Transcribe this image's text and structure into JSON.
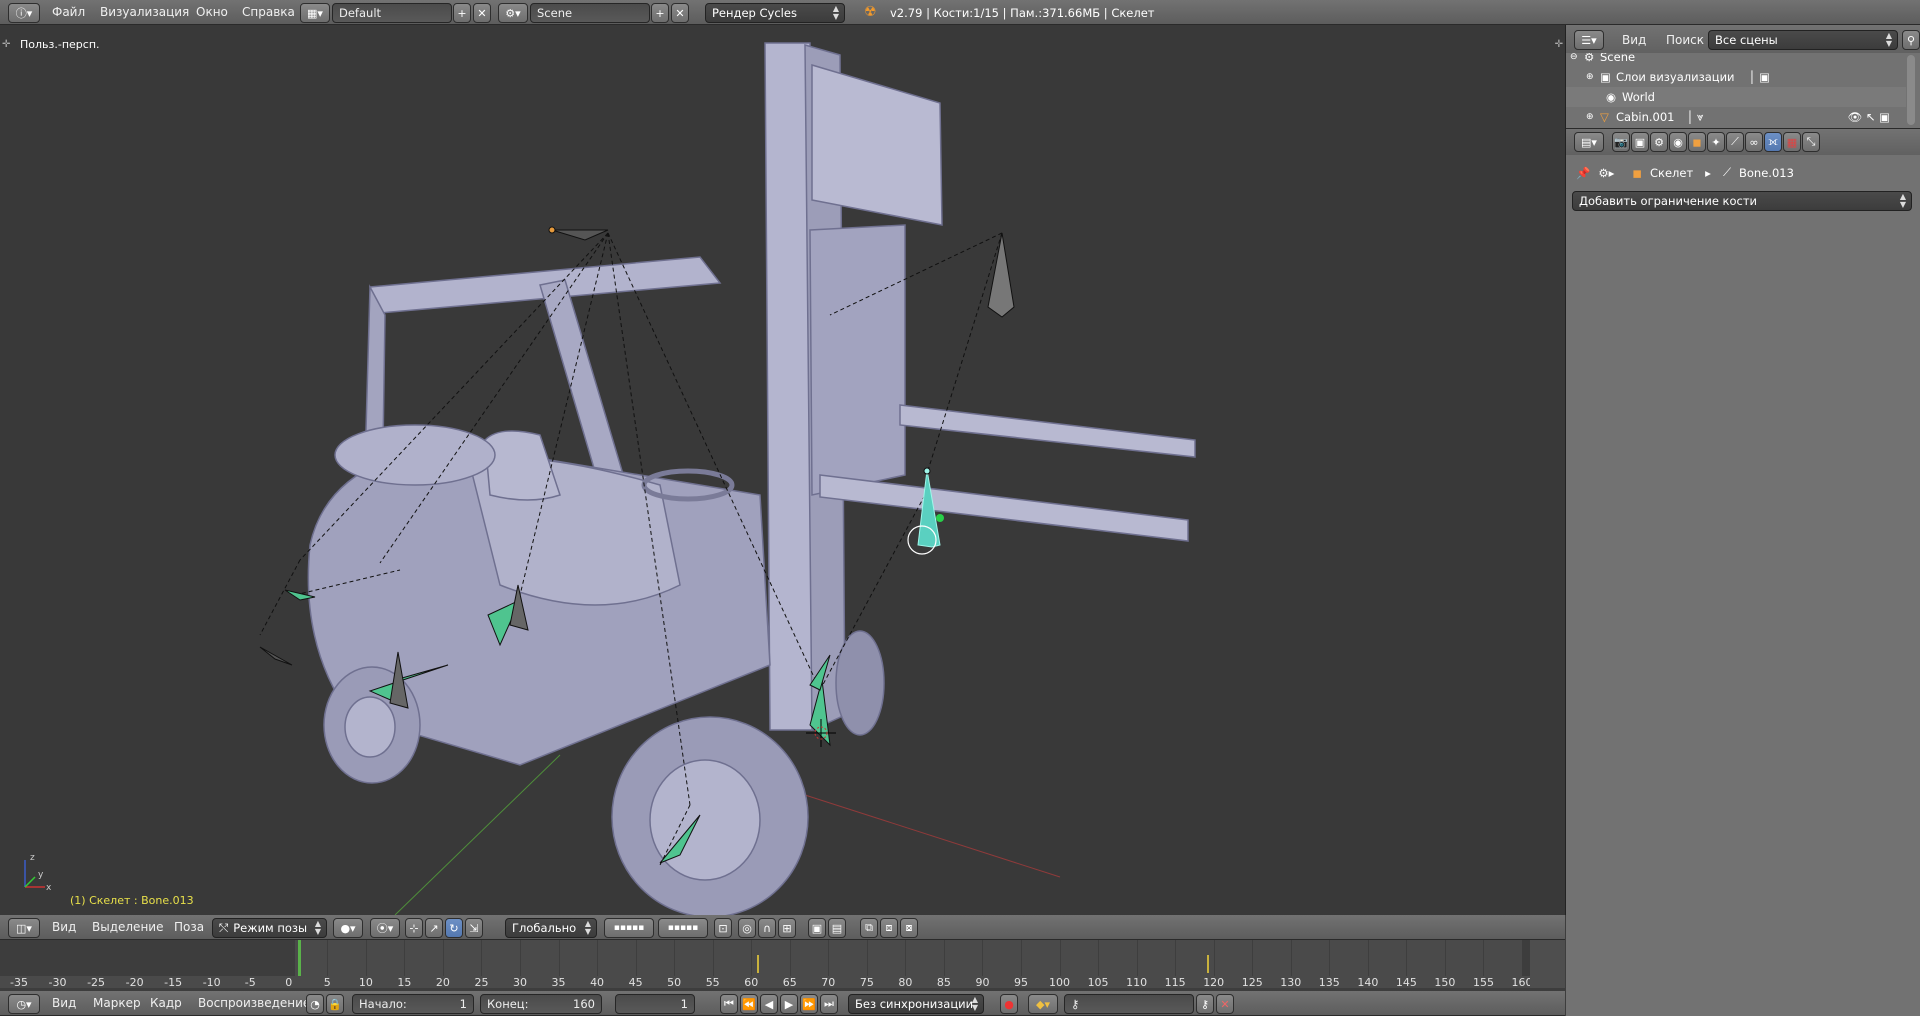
{
  "info_bar": {
    "menus": [
      "Файл",
      "Визуализация",
      "Окно",
      "Справка"
    ],
    "screen_layout": "Default",
    "scene": "Scene",
    "render_engine": "Рендер Cycles",
    "status": "v2.79 | Кости:1/15  | Пам.:371.66МБ | Скелет"
  },
  "viewport": {
    "view_label": "Польз.-персп.",
    "selection_label": "(1) Скелет : Bone.013",
    "axis_labels": {
      "x": "x",
      "y": "y",
      "z": "z"
    }
  },
  "view3d_header": {
    "menus": [
      "Вид",
      "Выделение",
      "Поза"
    ],
    "mode": "Режим позы",
    "orientation": "Глобально"
  },
  "outliner": {
    "header_menus": [
      "Вид",
      "Поиск"
    ],
    "filter": "Все сцены",
    "rows": [
      {
        "label": "Scene"
      },
      {
        "label": "Слои визуализации"
      },
      {
        "label": "World"
      },
      {
        "label": "Cabin.001"
      }
    ]
  },
  "properties": {
    "breadcrumb": [
      "Скелет",
      "Bone.013"
    ],
    "add_constraint": "Добавить ограничение кости"
  },
  "timeline": {
    "ticks": [
      "-35",
      "-30",
      "-25",
      "-20",
      "-15",
      "-10",
      "-5",
      "0",
      "5",
      "10",
      "15",
      "20",
      "25",
      "30",
      "35",
      "40",
      "45",
      "50",
      "55",
      "60",
      "65",
      "70",
      "75",
      "80",
      "85",
      "90",
      "95",
      "100",
      "105",
      "110",
      "115",
      "120",
      "125",
      "130",
      "135",
      "140",
      "145",
      "150",
      "155",
      "160"
    ],
    "current_frame_marker": "1",
    "menus": [
      "Вид",
      "Маркер",
      "Кадр",
      "Воспроизведение"
    ],
    "start_label": "Начало:",
    "start_value": "1",
    "end_label": "Конец:",
    "end_value": "160",
    "current_frame": "1",
    "sync": "Без синхронизации"
  },
  "colors": {
    "header_bg": "#6a6a6a",
    "viewport_bg": "#393939",
    "selected_bone": "#6fe3d0",
    "bone_green": "#4fc48f",
    "text_highlight": "#e8e04a"
  }
}
